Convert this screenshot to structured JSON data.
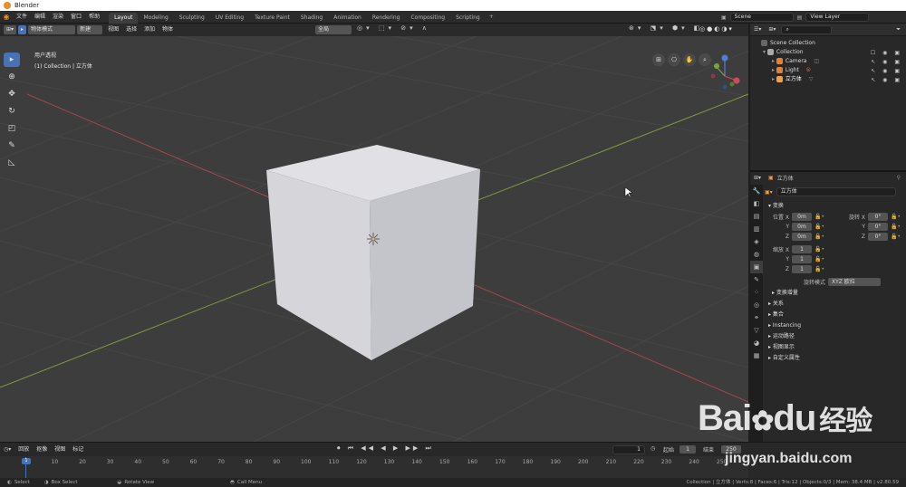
{
  "window": {
    "title": "Blender"
  },
  "menu": [
    "文件",
    "编辑",
    "渲染",
    "窗口",
    "帮助"
  ],
  "workspaces": [
    "Layout",
    "Modeling",
    "Sculpting",
    "UV Editing",
    "Texture Paint",
    "Shading",
    "Animation",
    "Rendering",
    "Compositing",
    "Scripting"
  ],
  "active_workspace": "Layout",
  "scene": {
    "name": "Scene",
    "view_layer": "View Layer"
  },
  "viewport": {
    "mode": "物体模式",
    "new_label": "新建",
    "menus": [
      "视图",
      "选择",
      "添加",
      "物体"
    ],
    "orientation": "全局",
    "view_name": "用户透视",
    "collection_path": "(1) Collection | 立方体"
  },
  "outliner": {
    "scene_collection": "Scene Collection",
    "collection": "Collection",
    "items": [
      "Camera",
      "Light",
      "立方体"
    ]
  },
  "properties": {
    "object_name": "立方体",
    "datablock": "立方体",
    "transform_title": "变换",
    "location_label": "位置 X",
    "rotation_label": "旋转 X",
    "scale_label": "缩放 X",
    "loc": [
      "0m",
      "0m",
      "0m"
    ],
    "rot": [
      "0°",
      "0°",
      "0°"
    ],
    "scale": [
      "1",
      "1",
      "1"
    ],
    "axis": [
      "Y",
      "Z"
    ],
    "rotation_mode_label": "旋转模式",
    "rotation_mode": "XYZ 欧拉",
    "delta": "变换增量",
    "sections": [
      "关系",
      "集合",
      "Instancing",
      "运动路径",
      "视图显示",
      "自定义属性"
    ]
  },
  "timeline": {
    "menus": [
      "回放",
      "抠像",
      "视图",
      "标记"
    ],
    "current_frame": "1",
    "start_label": "起始",
    "start": "1",
    "end_label": "结束",
    "end": "250",
    "ticks": [
      "0",
      "10",
      "20",
      "30",
      "40",
      "50",
      "60",
      "70",
      "80",
      "90",
      "100",
      "110",
      "120",
      "130",
      "140",
      "150",
      "160",
      "170",
      "180",
      "190",
      "200",
      "210",
      "220",
      "230",
      "240",
      "250"
    ]
  },
  "status": {
    "select": "Select",
    "box_select": "Box Select",
    "rotate_view": "Rotate View",
    "call_menu": "Call Menu",
    "stats": "Collection | 立方体 | Verts:8 | Faces:6 | Tris:12 | Objects:0/3 | Mem: 38.4 MB | v2.80.59"
  },
  "watermark": {
    "brand": "Bai",
    "brand2": "du",
    "cn": "经验",
    "url": "jingyan.baidu.com"
  }
}
